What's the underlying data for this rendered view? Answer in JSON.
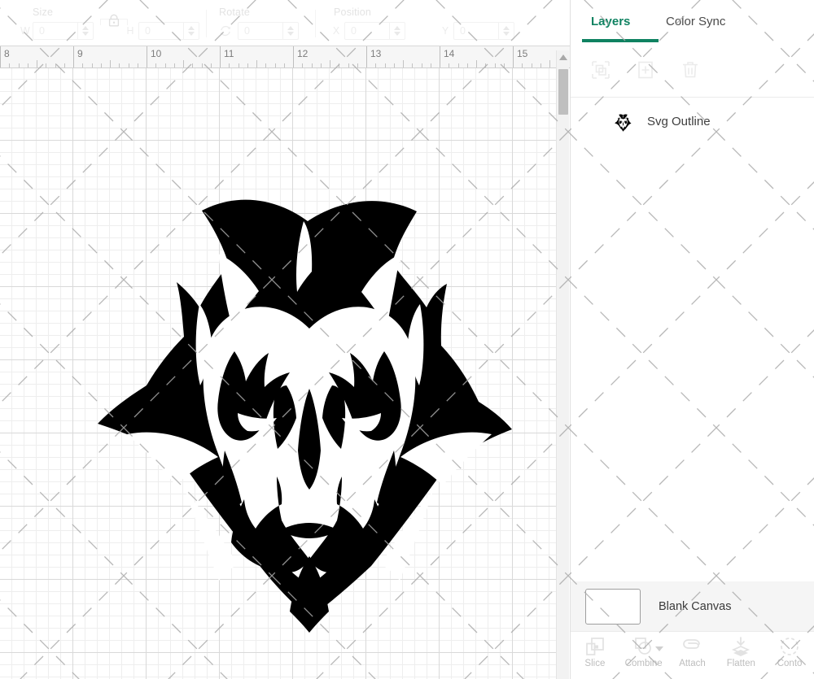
{
  "toolbar": {
    "size": {
      "label": "Size",
      "width_letter": "W",
      "width_value": "0",
      "height_letter": "H",
      "height_value": "0",
      "lock_icon": "lock-icon"
    },
    "rotate": {
      "label": "Rotate",
      "icon": "rotate-icon",
      "value": "0"
    },
    "position": {
      "label": "Position",
      "x_letter": "X",
      "x_value": "0",
      "y_letter": "Y",
      "y_value": "0"
    }
  },
  "ruler": {
    "unit_label_start": 8,
    "ticks": [
      "8",
      "9",
      "10",
      "11",
      "12",
      "13",
      "14",
      "15"
    ],
    "pixels_per_inch": 90
  },
  "canvas": {
    "grid_visible": true,
    "artwork_name": "devil-head-silhouette",
    "artwork_color": "#000000"
  },
  "scrollbar": {
    "up_arrow_icon": "caret-up-icon",
    "orientation": "vertical"
  },
  "panel": {
    "tabs": [
      {
        "label": "Layers",
        "active": true
      },
      {
        "label": "Color Sync",
        "active": false
      }
    ],
    "accent_color": "#0f8261",
    "tools": [
      {
        "name": "duplicate-selection-icon",
        "enabled": false
      },
      {
        "name": "add-layer-icon",
        "enabled": false
      },
      {
        "name": "delete-layer-icon",
        "enabled": false
      }
    ],
    "layers": [
      {
        "name": "Svg Outline",
        "thumb": "devil-head-icon"
      }
    ],
    "canvas_row": {
      "label": "Blank Canvas",
      "swatch_color": "#ffffff"
    },
    "bottom_tools": [
      {
        "label": "Slice",
        "icon": "slice-icon",
        "has_dropdown": false
      },
      {
        "label": "Combine",
        "icon": "combine-icon",
        "has_dropdown": true
      },
      {
        "label": "Attach",
        "icon": "attach-icon",
        "has_dropdown": false
      },
      {
        "label": "Flatten",
        "icon": "flatten-icon",
        "has_dropdown": false
      },
      {
        "label": "Conto",
        "icon": "contour-icon",
        "has_dropdown": false
      }
    ]
  }
}
